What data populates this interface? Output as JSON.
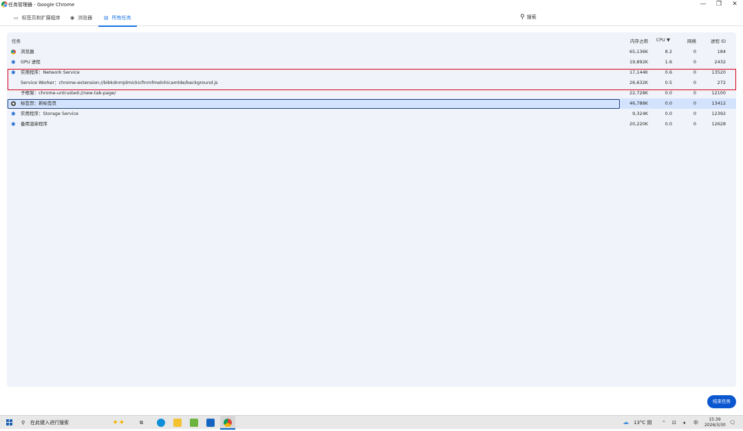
{
  "window": {
    "title": "任务管理器 - Google Chrome",
    "minimize": "—",
    "restore": "❐",
    "close": "✕"
  },
  "tabs": [
    {
      "label": "标签页和扩展程序",
      "icon": "tab-window-icon"
    },
    {
      "label": "浏览器",
      "icon": "chrome-icon"
    },
    {
      "label": "所有任务",
      "icon": "list-icon"
    }
  ],
  "search": {
    "placeholder": "搜索",
    "icon": "search-icon"
  },
  "table": {
    "headers": {
      "task": "任务",
      "memory": "内存占用",
      "cpu": "CPU ▼",
      "network": "网络",
      "pid": "进程 ID"
    },
    "rows": [
      {
        "task": "浏览器",
        "memory": "65,136K",
        "cpu": "8.2",
        "network": "0",
        "pid": "184",
        "icon": "chrome-icon"
      },
      {
        "task": "GPU 进程",
        "memory": "19,892K",
        "cpu": "1.6",
        "network": "0",
        "pid": "2432",
        "icon": "puzzle-icon"
      },
      {
        "task": "实用程序：Network Service",
        "memory": "17,144K",
        "cpu": "0.6",
        "network": "0",
        "pid": "13520",
        "icon": "puzzle-icon"
      },
      {
        "task": "Service Worker：chrome-extension://bibkdnmjdmickicfinmfmelnhicamlde/background.js",
        "memory": "26,632K",
        "cpu": "0.5",
        "network": "0",
        "pid": "272",
        "icon": ""
      },
      {
        "task": "子框架：chrome-untrusted://new-tab-page/",
        "memory": "22,728K",
        "cpu": "0.0",
        "network": "0",
        "pid": "12100",
        "icon": ""
      },
      {
        "task": "标签页：新标签页",
        "memory": "46,788K",
        "cpu": "0.0",
        "network": "0",
        "pid": "13412",
        "icon": "tab-icon"
      },
      {
        "task": "实用程序：Storage Service",
        "memory": "9,324K",
        "cpu": "0.0",
        "network": "0",
        "pid": "12392",
        "icon": "puzzle-icon"
      },
      {
        "task": "备用渲染程序",
        "memory": "20,220K",
        "cpu": "0.0",
        "network": "0",
        "pid": "12628",
        "icon": "puzzle-icon"
      }
    ]
  },
  "end_task_button": "结束任务",
  "taskbar": {
    "search_placeholder": "在此键入进行搜索",
    "weather": "13°C 阴",
    "ime": "中",
    "time": "15:39",
    "date": "2026/3/30"
  },
  "colors": {
    "accent": "#1a73e8",
    "panel": "#f0f3f9",
    "selected_row": "#d3e3fd",
    "highlight_box": "#d9001b"
  }
}
